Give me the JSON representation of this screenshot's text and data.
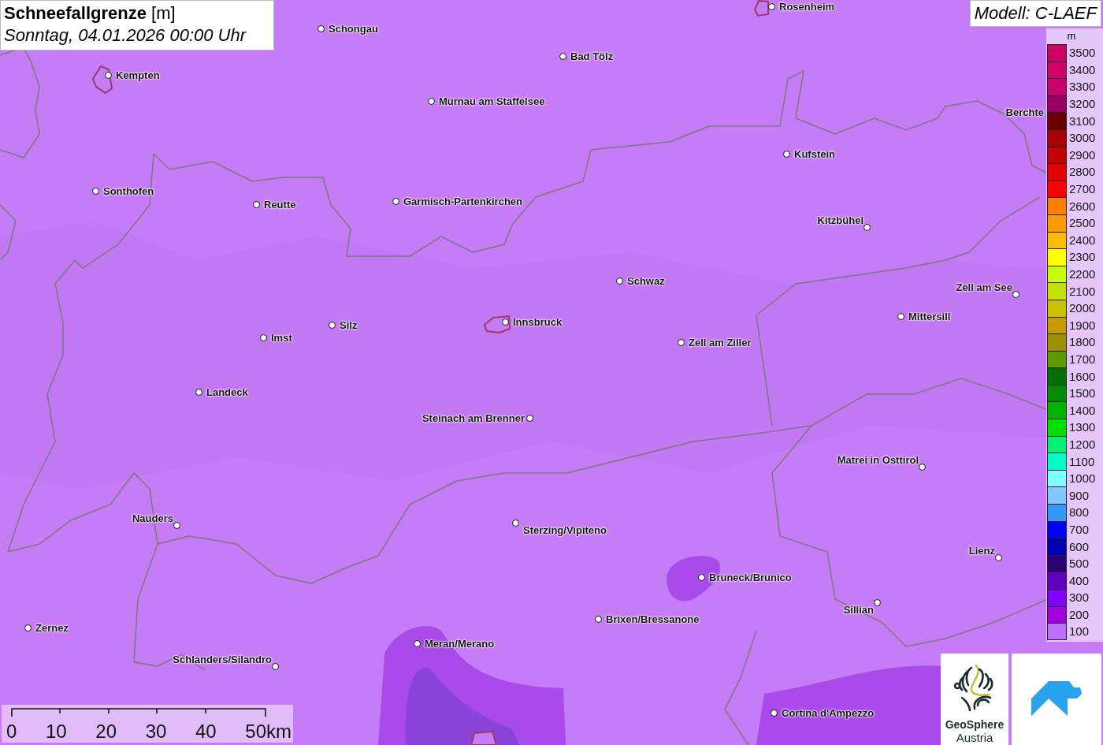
{
  "title": {
    "heading": "**Schneefallgrenze** [m]",
    "subtitle": "Sonntag, 04.01.2026 00:00 Uhr"
  },
  "model": "Modell: C-LAEF",
  "cities": [
    {
      "name": "Rosenheim"
    },
    {
      "name": "Schongau"
    },
    {
      "name": "Bad Tölz"
    },
    {
      "name": "Kempten"
    },
    {
      "name": "Murnau am Staffelsee"
    },
    {
      "name": "Berchte"
    },
    {
      "name": "Kufstein"
    },
    {
      "name": "Sonthofen"
    },
    {
      "name": "Reutte"
    },
    {
      "name": "Garmisch-Partenkirchen"
    },
    {
      "name": "Kitzbühel"
    },
    {
      "name": "Schwaz"
    },
    {
      "name": "Zell am See"
    },
    {
      "name": "Mittersill"
    },
    {
      "name": "Innsbruck"
    },
    {
      "name": "Silz"
    },
    {
      "name": "Imst"
    },
    {
      "name": "Zell am Ziller"
    },
    {
      "name": "Landeck"
    },
    {
      "name": "Steinach am Brenner"
    },
    {
      "name": "Matrei in Osttirol"
    },
    {
      "name": "Nauders"
    },
    {
      "name": "Sterzing/Vipiteno"
    },
    {
      "name": "Lienz"
    },
    {
      "name": "Bruneck/Brunico"
    },
    {
      "name": "Sillian"
    },
    {
      "name": "Brixen/Bressanone"
    },
    {
      "name": "Zernez"
    },
    {
      "name": "Meran/Merano"
    },
    {
      "name": "Schlanders/Silandro"
    },
    {
      "name": "Cortina d'Ampezzo"
    }
  ],
  "legend": {
    "unit": "m",
    "items": [
      {
        "label": "3500",
        "color": "#cc0066"
      },
      {
        "label": "3400",
        "color": "#d4006a"
      },
      {
        "label": "3300",
        "color": "#c8006e"
      },
      {
        "label": "3200",
        "color": "#990066"
      },
      {
        "label": "3100",
        "color": "#6b0000"
      },
      {
        "label": "3000",
        "color": "#a80000"
      },
      {
        "label": "2900",
        "color": "#c40000"
      },
      {
        "label": "2800",
        "color": "#e00000"
      },
      {
        "label": "2700",
        "color": "#ff0000"
      },
      {
        "label": "2600",
        "color": "#ff7f00"
      },
      {
        "label": "2500",
        "color": "#ff9900"
      },
      {
        "label": "2400",
        "color": "#ffbb00"
      },
      {
        "label": "2300",
        "color": "#ffff00"
      },
      {
        "label": "2200",
        "color": "#c8ff00"
      },
      {
        "label": "2100",
        "color": "#c8e000"
      },
      {
        "label": "2000",
        "color": "#c8c000"
      },
      {
        "label": "1900",
        "color": "#c89c00"
      },
      {
        "label": "1800",
        "color": "#9c9000"
      },
      {
        "label": "1700",
        "color": "#5c9c00"
      },
      {
        "label": "1600",
        "color": "#007000"
      },
      {
        "label": "1500",
        "color": "#008c00"
      },
      {
        "label": "1400",
        "color": "#00b400"
      },
      {
        "label": "1300",
        "color": "#00e000"
      },
      {
        "label": "1200",
        "color": "#00f078"
      },
      {
        "label": "1100",
        "color": "#00ffc8"
      },
      {
        "label": "1000",
        "color": "#80ffff"
      },
      {
        "label": "900",
        "color": "#80c8ff"
      },
      {
        "label": "800",
        "color": "#3399ff"
      },
      {
        "label": "700",
        "color": "#0000ff"
      },
      {
        "label": "600",
        "color": "#0000b4"
      },
      {
        "label": "500",
        "color": "#2c0070"
      },
      {
        "label": "400",
        "color": "#6000c0"
      },
      {
        "label": "300",
        "color": "#8000ff"
      },
      {
        "label": "200",
        "color": "#a000e0"
      },
      {
        "label": "100",
        "color": "#c070ff"
      }
    ]
  },
  "scale_bar": {
    "labels": [
      "0",
      "10",
      "20",
      "30",
      "40",
      "50km"
    ]
  },
  "logos": {
    "name": "GeoSphere",
    "subname": "Austria"
  }
}
